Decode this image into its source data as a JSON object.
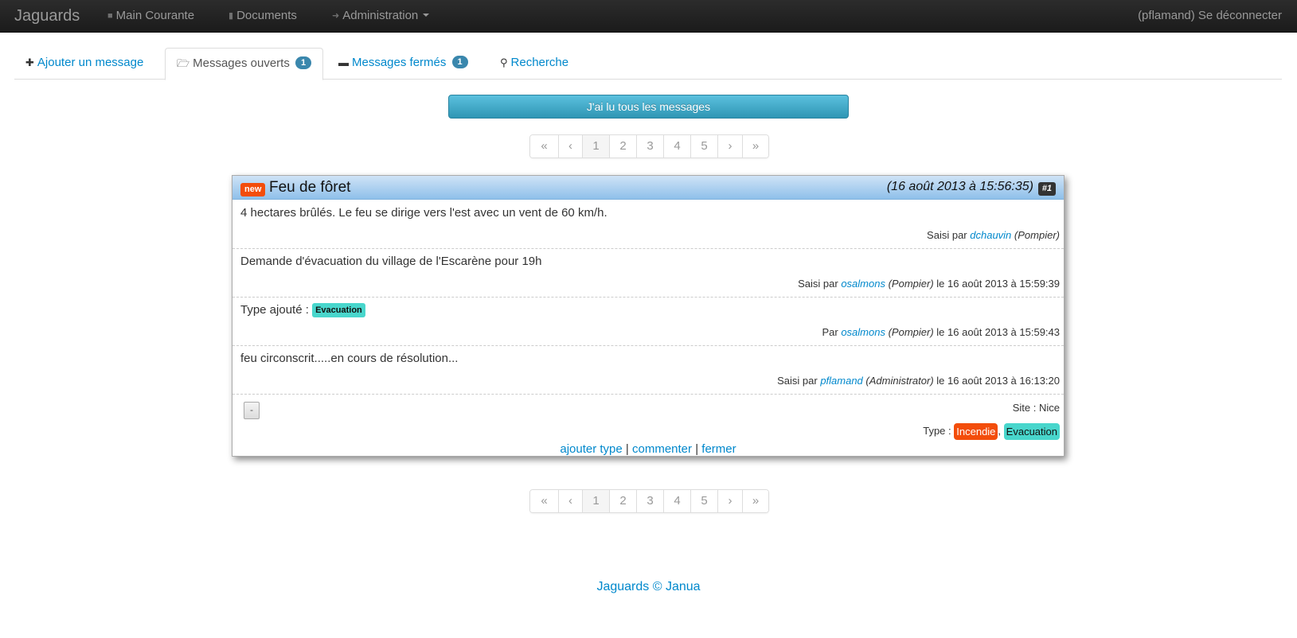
{
  "navbar": {
    "brand": "Jaguards",
    "items": [
      {
        "label": "Main Courante",
        "icon": "comment-icon"
      },
      {
        "label": "Documents",
        "icon": "file-icon"
      },
      {
        "label": "Administration",
        "icon": "wrench-icon"
      }
    ],
    "logout": "(pflamand) Se déconnecter"
  },
  "tabs": [
    {
      "label": "Ajouter un message",
      "icon": "plus-icon"
    },
    {
      "label": "Messages ouverts",
      "icon": "folder-open-icon",
      "badge": "1",
      "active": true
    },
    {
      "label": "Messages fermés",
      "icon": "folder-icon",
      "badge": "1"
    },
    {
      "label": "Recherche",
      "icon": "search-icon"
    }
  ],
  "read_all_label": "J'ai lu tous les messages",
  "pagination": {
    "items": [
      "«",
      "‹",
      "1",
      "2",
      "3",
      "4",
      "5",
      "›",
      "»"
    ],
    "current": "1"
  },
  "message": {
    "new_label": "new",
    "title": "Feu de fôret",
    "date": "(16 août 2013 à 15:56:35)",
    "number": "#1",
    "entries": [
      {
        "text": "4 hectares brûlés. Le feu se dirige vers l'est avec un vent de 60 km/h.",
        "prefix": "Saisi par",
        "user": "dchauvin",
        "role": "(Pompier)",
        "when": ""
      },
      {
        "text": "Demande d'évacuation du village de l'Escarène pour 19h",
        "prefix": "Saisi par",
        "user": "osalmons",
        "role": "(Pompier)",
        "when": "le 16 août 2013 à 15:59:39"
      },
      {
        "text": "Type ajouté :",
        "type_label": "Evacuation",
        "prefix": "Par",
        "user": "osalmons",
        "role": "(Pompier)",
        "when": "le 16 août 2013 à 15:59:43"
      },
      {
        "text": "feu circonscrit.....en cours de résolution...",
        "prefix": "Saisi par",
        "user": "pflamand",
        "role": "(Administrator)",
        "when": "le 16 août 2013 à 16:13:20"
      }
    ],
    "collapse_label": "-",
    "site": "Site : Nice",
    "type_prefix": "Type :",
    "types": [
      {
        "label": "Incendie",
        "bg": "#f34d0b",
        "fg": "#ffffff"
      },
      {
        "label": "Evacuation",
        "bg": "#48d6cc",
        "fg": "#111111"
      }
    ],
    "type_separator": ",",
    "actions": [
      "ajouter type",
      "commenter",
      "fermer"
    ],
    "action_separator": "|"
  },
  "footer": "Jaguards © Janua",
  "colors": {
    "accent": "#0088cc",
    "navbar": "#1b1b1b",
    "badge": "#3a87ad",
    "new_label": "#f34d0b"
  }
}
